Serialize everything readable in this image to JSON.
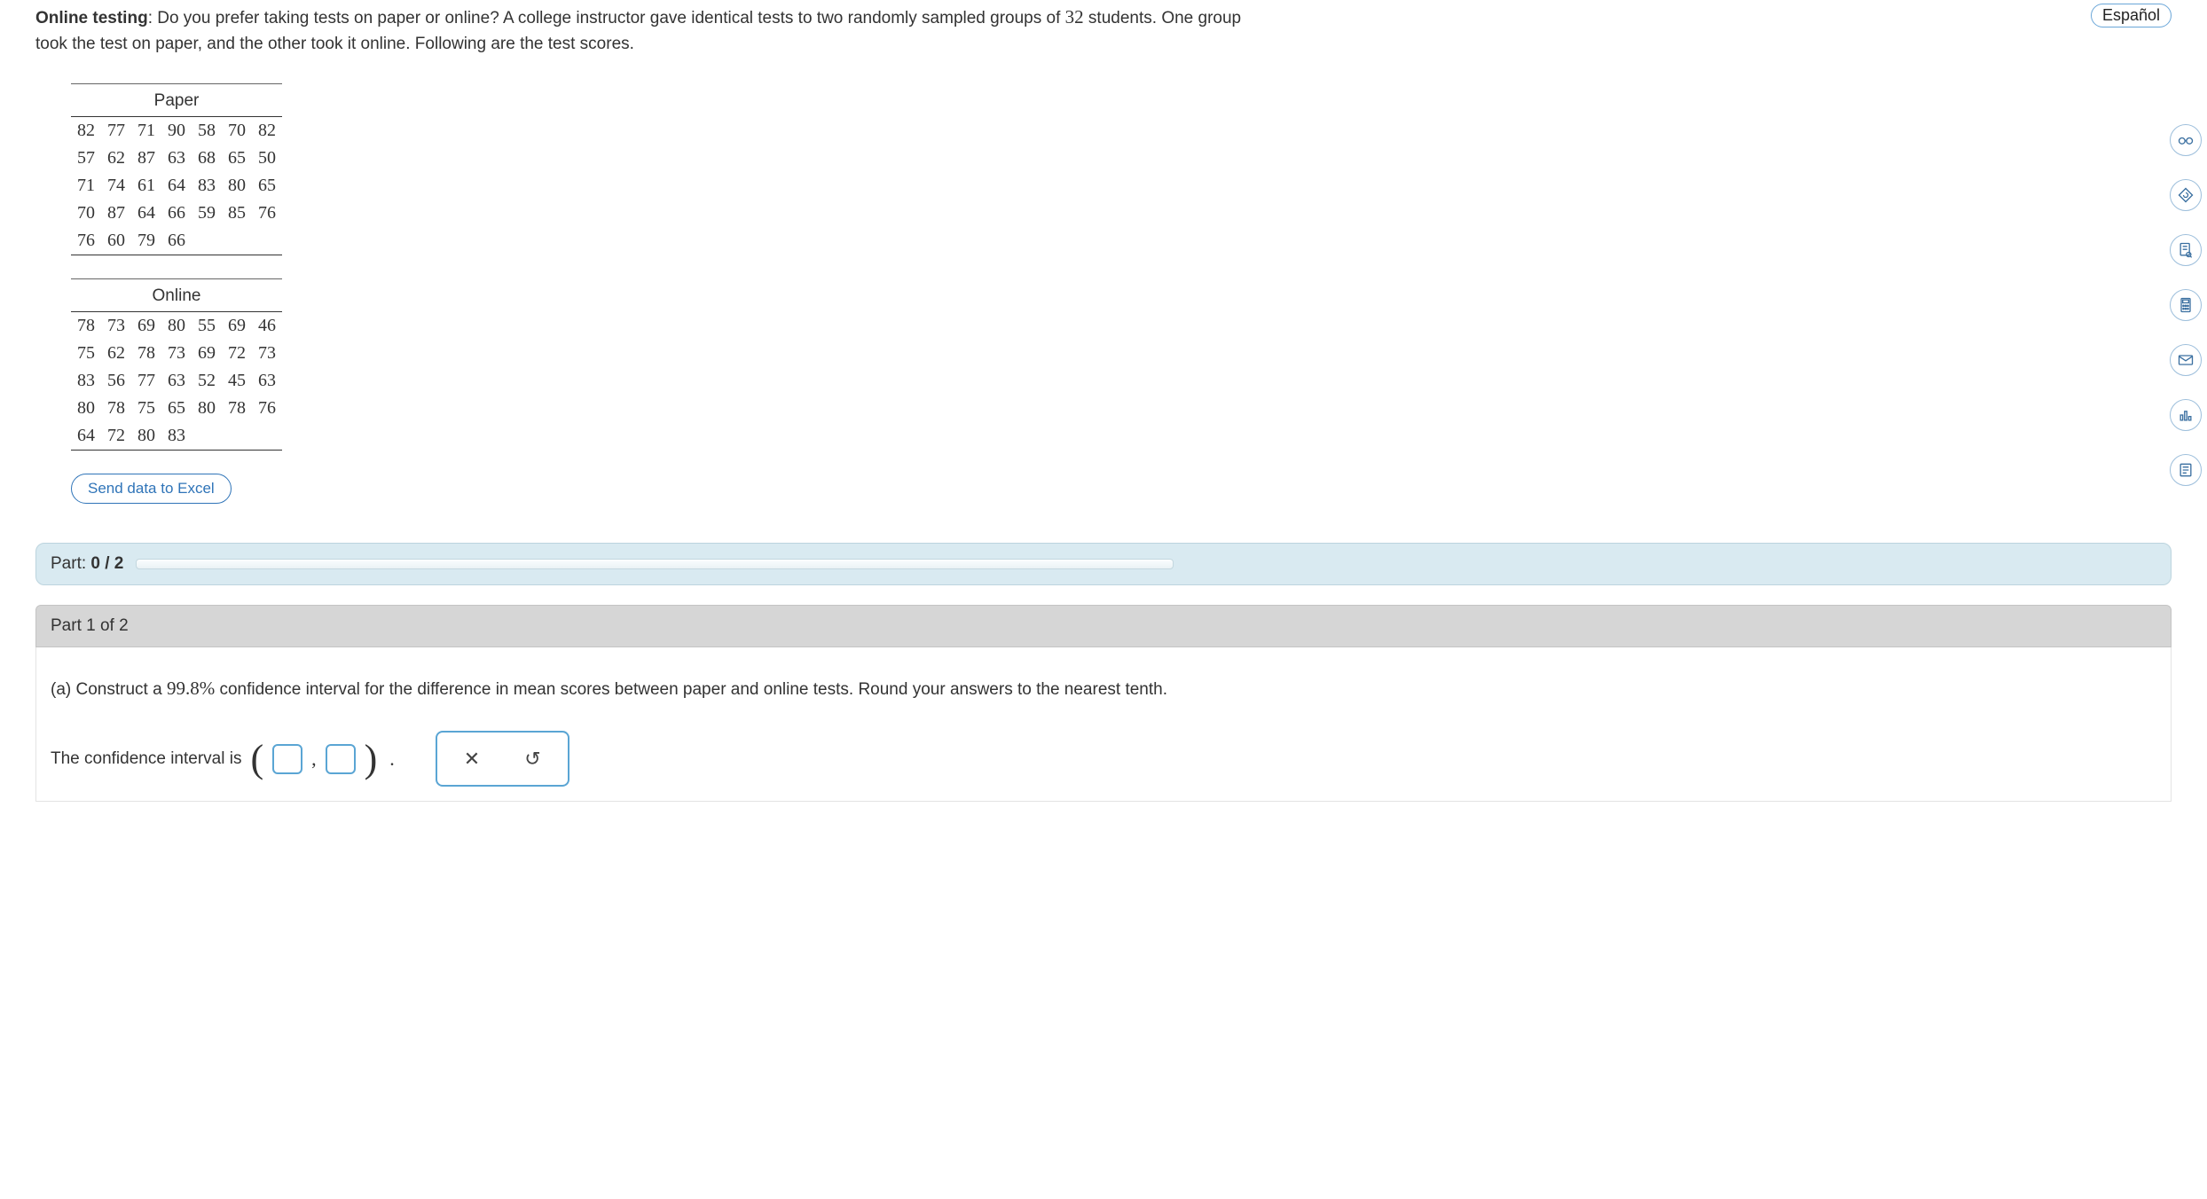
{
  "header": {
    "language_label": "Español"
  },
  "problem": {
    "lead_bold": "Online testing",
    "sample_size": "32",
    "text_before": ": Do you prefer taking tests on paper or online? A college instructor gave identical tests to two randomly sampled groups of ",
    "text_after": " students. One group took the test on paper, and the other took it online. Following are the test scores."
  },
  "tables": {
    "paper": {
      "title": "Paper",
      "rows": [
        [
          "82",
          "77",
          "71",
          "90",
          "58",
          "70",
          "82"
        ],
        [
          "57",
          "62",
          "87",
          "63",
          "68",
          "65",
          "50"
        ],
        [
          "71",
          "74",
          "61",
          "64",
          "83",
          "80",
          "65"
        ],
        [
          "70",
          "87",
          "64",
          "66",
          "59",
          "85",
          "76"
        ],
        [
          "76",
          "60",
          "79",
          "66",
          "",
          "",
          ""
        ]
      ]
    },
    "online": {
      "title": "Online",
      "rows": [
        [
          "78",
          "73",
          "69",
          "80",
          "55",
          "69",
          "46"
        ],
        [
          "75",
          "62",
          "78",
          "73",
          "69",
          "72",
          "73"
        ],
        [
          "83",
          "56",
          "77",
          "63",
          "52",
          "45",
          "63"
        ],
        [
          "80",
          "78",
          "75",
          "65",
          "80",
          "78",
          "76"
        ],
        [
          "64",
          "72",
          "80",
          "83",
          "",
          "",
          ""
        ]
      ]
    }
  },
  "buttons": {
    "send_excel": "Send data to Excel"
  },
  "progress": {
    "label_prefix": "Part: ",
    "value": "0 / 2"
  },
  "part1": {
    "header": "Part 1 of 2",
    "qletter": "(a) ",
    "text_before": "Construct a ",
    "pct": "99.8%",
    "text_after": " confidence interval for the difference in mean scores between paper and online tests. Round your answers to the nearest tenth.",
    "ci_text": "The confidence interval is "
  },
  "icons": {
    "clear": "✕",
    "reset": "↺"
  },
  "side": {
    "t1": "glasses",
    "t2": "refresh-diamond",
    "t3": "doc-search",
    "t4": "calculator",
    "t5": "mail",
    "t6": "bar-chart",
    "t7": "list-doc"
  }
}
